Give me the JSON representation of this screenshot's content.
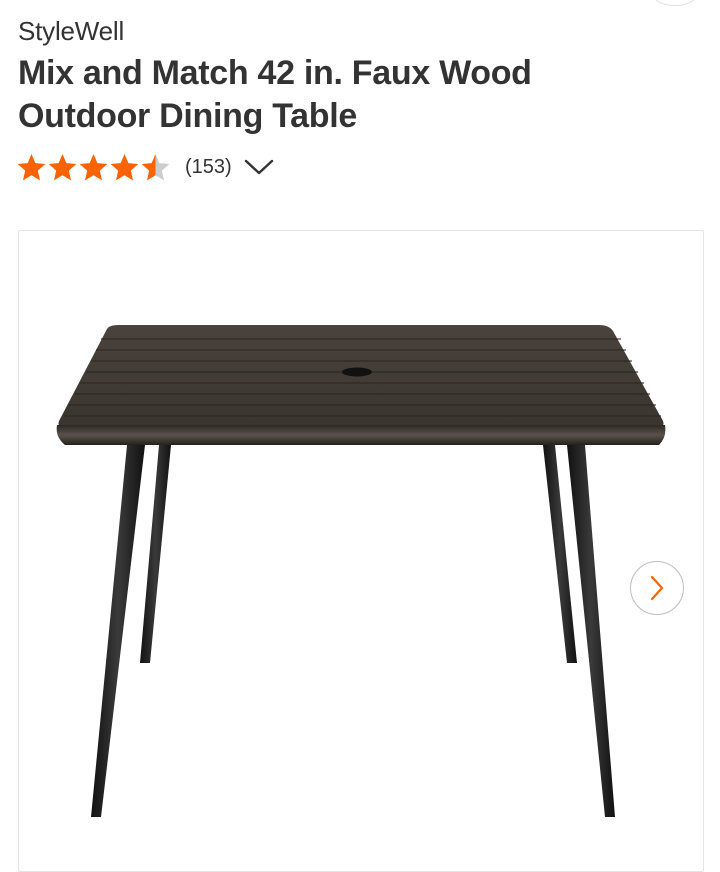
{
  "product": {
    "brand": "StyleWell",
    "title": "Mix and Match 42 in. Faux Wood Outdoor Dining Table",
    "rating": 4.5,
    "rating_max": 5,
    "review_count": "(153)"
  },
  "colors": {
    "star": "#f96302",
    "star_empty": "#cccccc",
    "text": "#333333",
    "next_arrow": "#f96302"
  },
  "icons": {
    "star": "star-icon",
    "half_star": "half-star-icon",
    "expand": "chevron-down-icon",
    "next": "chevron-right-icon"
  }
}
